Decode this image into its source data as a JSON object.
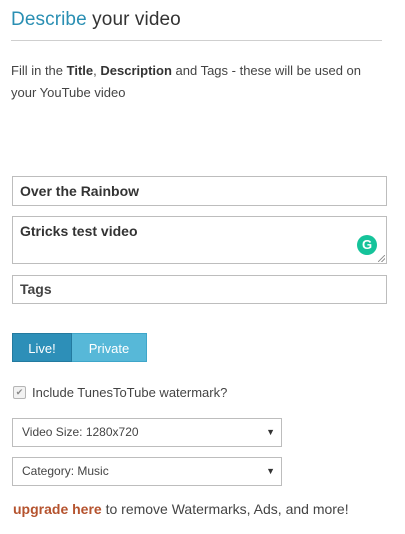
{
  "header": {
    "title_accent": "Describe",
    "title_rest": "your video"
  },
  "intro": {
    "part1": "Fill in the ",
    "bold1": "Title",
    "part2": ", ",
    "bold2": "Description",
    "part3": " and Tags - these will be used on your YouTube video"
  },
  "form": {
    "title_value": "Over the Rainbow",
    "description_value": "Gtricks test video",
    "tags_placeholder": "Tags",
    "grammarly_icon": "grammarly-icon",
    "grammarly_glyph": "G"
  },
  "visibility": {
    "live_label": "Live!",
    "private_label": "Private",
    "selected": "Live!"
  },
  "watermark": {
    "label": "Include TunesToTube watermark?",
    "checked": true,
    "check_glyph": "✔"
  },
  "selects": {
    "size_value": "Video Size: 1280x720",
    "category_value": "Category: Music",
    "arrow_glyph": "▼"
  },
  "upgrade": {
    "link_text": "upgrade here",
    "rest_text": " to remove Watermarks, Ads, and more!"
  },
  "colors": {
    "accent": "#2a8fb3",
    "live_button": "#2d8fb8",
    "private_button": "#57b8d8",
    "upgrade_link": "#b5532e",
    "grammarly": "#15c39a"
  }
}
